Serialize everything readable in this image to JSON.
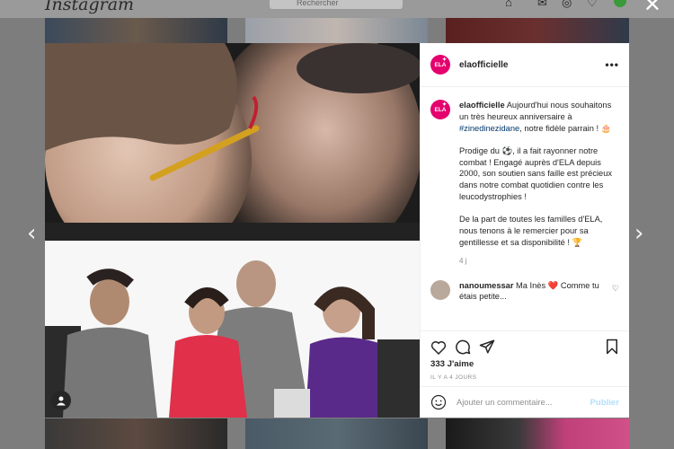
{
  "app": {
    "logo_text": "Instagram"
  },
  "search": {
    "placeholder": "Rechercher"
  },
  "post": {
    "username": "elaofficielle",
    "avatar_text": "ELA",
    "caption": {
      "username": "elaofficielle",
      "line1_before": "Aujourd'hui nous souhaitons un très heureux anniversaire à ",
      "hashtag": "#zinedinezidane",
      "line1_after": ", notre fidèle parrain ! 🎂",
      "para2": "Prodige du ⚽, il a fait rayonner notre combat ! Engagé auprès d'ELA depuis 2000, son soutien sans faille est précieux dans notre combat quotidien contre les leucodystrophies !",
      "para3": "De la part de toutes les familles d'ELA, nous tenons à le remercier pour sa gentillesse et sa disponibilité ! 🏆",
      "time": "4 j"
    },
    "comment": {
      "username": "nanoumessar",
      "text": "Ma Inès ❤️ Comme tu étais petite..."
    },
    "likes": "333 J'aime",
    "posted_ago": "IL Y A 4 JOURS",
    "add_comment_placeholder": "Ajouter un commentaire...",
    "publish_label": "Publier"
  },
  "colors": {
    "brand": "#e4006d",
    "hashtag": "#00376b",
    "publish_disabled": "#b2dffc"
  },
  "icons": [
    "close-icon",
    "prev-arrow-icon",
    "next-arrow-icon",
    "more-icon",
    "heart-icon",
    "comment-icon",
    "share-icon",
    "bookmark-icon",
    "emoji-icon",
    "user-tag-icon"
  ]
}
